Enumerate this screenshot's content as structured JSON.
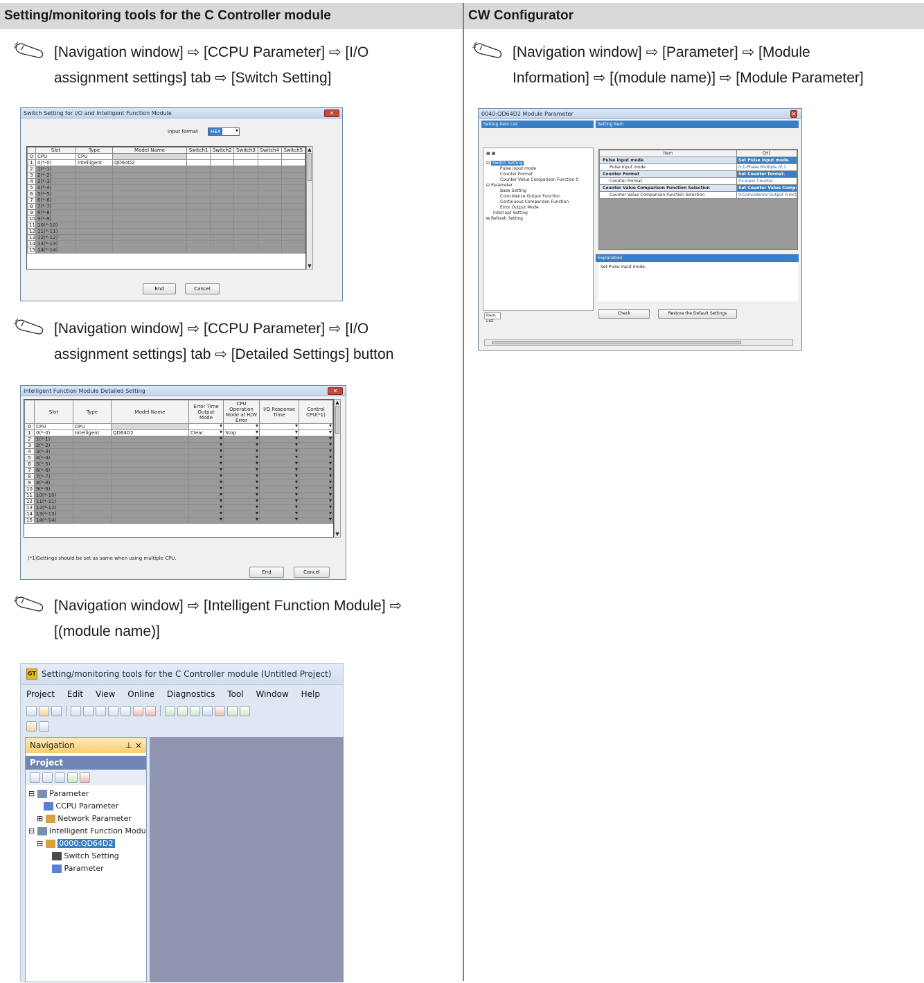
{
  "headers": {
    "left": "Setting/monitoring tools for the C Controller module",
    "right": "CW Configurator"
  },
  "steps": {
    "s1_line1": "[Navigation window] ⇨ [CCPU Parameter] ⇨ [I/O",
    "s1_line2": "assignment settings] tab ⇨ [Switch Setting]",
    "s2_line1": "[Navigation window] ⇨ [CCPU Parameter] ⇨ [I/O",
    "s2_line2": "assignment settings] tab ⇨ [Detailed Settings] button",
    "s3_line1": "[Navigation window] ⇨ [Intelligent Function Module] ⇨",
    "s3_line2": "[(module name)]",
    "r1_line1": "[Navigation window] ⇨ [Parameter] ⇨ [Module",
    "r1_line2": "Information] ⇨ [(module name)] ⇨ [Module Parameter]"
  },
  "switch_dialog": {
    "title": "Switch Setting for I/O and Intelligent Function Module",
    "input_format_label": "Input format",
    "input_format_value": "HEX",
    "columns": [
      "Slot",
      "Type",
      "Model Name",
      "Switch1",
      "Switch2",
      "Switch3",
      "Switch4",
      "Switch5"
    ],
    "rows": [
      {
        "n": "0",
        "slot": "CPU",
        "type": "CPU",
        "model": ""
      },
      {
        "n": "1",
        "slot": "0(*-0)",
        "type": "Intelligent",
        "model": "QD64D2"
      },
      {
        "n": "2",
        "slot": "1(*-1)",
        "type": "",
        "model": ""
      },
      {
        "n": "3",
        "slot": "2(*-2)",
        "type": "",
        "model": ""
      },
      {
        "n": "4",
        "slot": "3(*-3)",
        "type": "",
        "model": ""
      },
      {
        "n": "5",
        "slot": "4(*-4)",
        "type": "",
        "model": ""
      },
      {
        "n": "6",
        "slot": "5(*-5)",
        "type": "",
        "model": ""
      },
      {
        "n": "7",
        "slot": "6(*-6)",
        "type": "",
        "model": ""
      },
      {
        "n": "8",
        "slot": "7(*-7)",
        "type": "",
        "model": ""
      },
      {
        "n": "9",
        "slot": "8(*-8)",
        "type": "",
        "model": ""
      },
      {
        "n": "10",
        "slot": "9(*-9)",
        "type": "",
        "model": ""
      },
      {
        "n": "11",
        "slot": "10(*-10)",
        "type": "",
        "model": ""
      },
      {
        "n": "12",
        "slot": "11(*-11)",
        "type": "",
        "model": ""
      },
      {
        "n": "13",
        "slot": "12(*-12)",
        "type": "",
        "model": ""
      },
      {
        "n": "14",
        "slot": "13(*-13)",
        "type": "",
        "model": ""
      },
      {
        "n": "15",
        "slot": "14(*-14)",
        "type": "",
        "model": ""
      }
    ],
    "end_label": "End",
    "cancel_label": "Cancel"
  },
  "detail_dialog": {
    "title": "Intelligent Function Module Detailed Setting",
    "columns": [
      "Slot",
      "Type",
      "Model Name",
      "Error Time Output Mode",
      "CPU Operation Mode at H/W Error",
      "I/O Response Time",
      "Control CPU(*1)"
    ],
    "rows": [
      {
        "n": "0",
        "slot": "CPU",
        "type": "CPU",
        "model": "",
        "err": "",
        "cpu": ""
      },
      {
        "n": "1",
        "slot": "0(*-0)",
        "type": "Intelligent",
        "model": "QD64D2",
        "err": "Clear",
        "cpu": "Stop"
      },
      {
        "n": "2",
        "slot": "1(*-1)",
        "type": "",
        "model": "",
        "err": "",
        "cpu": ""
      },
      {
        "n": "3",
        "slot": "2(*-2)",
        "type": "",
        "model": "",
        "err": "",
        "cpu": ""
      },
      {
        "n": "4",
        "slot": "3(*-3)",
        "type": "",
        "model": "",
        "err": "",
        "cpu": ""
      },
      {
        "n": "5",
        "slot": "4(*-4)",
        "type": "",
        "model": "",
        "err": "",
        "cpu": ""
      },
      {
        "n": "6",
        "slot": "5(*-5)",
        "type": "",
        "model": "",
        "err": "",
        "cpu": ""
      },
      {
        "n": "7",
        "slot": "6(*-6)",
        "type": "",
        "model": "",
        "err": "",
        "cpu": ""
      },
      {
        "n": "8",
        "slot": "7(*-7)",
        "type": "",
        "model": "",
        "err": "",
        "cpu": ""
      },
      {
        "n": "9",
        "slot": "8(*-8)",
        "type": "",
        "model": "",
        "err": "",
        "cpu": ""
      },
      {
        "n": "10",
        "slot": "9(*-9)",
        "type": "",
        "model": "",
        "err": "",
        "cpu": ""
      },
      {
        "n": "11",
        "slot": "10(*-10)",
        "type": "",
        "model": "",
        "err": "",
        "cpu": ""
      },
      {
        "n": "12",
        "slot": "11(*-11)",
        "type": "",
        "model": "",
        "err": "",
        "cpu": ""
      },
      {
        "n": "13",
        "slot": "12(*-12)",
        "type": "",
        "model": "",
        "err": "",
        "cpu": ""
      },
      {
        "n": "14",
        "slot": "13(*-13)",
        "type": "",
        "model": "",
        "err": "",
        "cpu": ""
      },
      {
        "n": "15",
        "slot": "14(*-14)",
        "type": "",
        "model": "",
        "err": "",
        "cpu": ""
      }
    ],
    "footnote": "(*1)Settings should be set as same when using multiple CPU.",
    "end_label": "End",
    "cancel_label": "Cancel"
  },
  "gx_window": {
    "title": "Setting/monitoring tools for the C Controller module (Untitled Project)",
    "logo": "GT",
    "menu": [
      "Project",
      "Edit",
      "View",
      "Online",
      "Diagnostics",
      "Tool",
      "Window",
      "Help"
    ],
    "nav_title": "Navigation",
    "nav_pin": "⊥ ×",
    "project_label": "Project",
    "tree": {
      "parameter": "Parameter",
      "ccpu": "CCPU Parameter",
      "network": "Network Parameter",
      "ifm": "Intelligent Function Modu",
      "module": "0000:QD64D2",
      "switch": "Switch Setting",
      "param": "Parameter"
    }
  },
  "cw_dialog": {
    "title": "0040:QD64D2 Module Parameter",
    "setting_item_list": "Setting Item List",
    "setting_item": "Setting Item",
    "tree": [
      "Switch Setting",
      "Pulse input mode",
      "Counter Format",
      "Counter Value Comparison Function S",
      "Parameter",
      "Base Setting",
      "Coincidence Output Function",
      "Continuous Comparison Function",
      "Error Output Mode",
      "Interrupt Setting",
      "Refresh Setting"
    ],
    "col_item": "Item",
    "col_ch1": "CH1",
    "rows": [
      {
        "item": "Pulse input mode",
        "val": "Set Pulse input mode."
      },
      {
        "item": "Pulse input mode",
        "val": "0:1-Phase Multiple of 1"
      },
      {
        "item": "Counter Format",
        "val": "Set Counter format."
      },
      {
        "item": "Counter Format",
        "val": "0:Linear Counter"
      },
      {
        "item": "Counter Value Comparison Function Selection",
        "val": "Set Counter Value Compar"
      },
      {
        "item": "Counter Value Comparison Function Selection",
        "val": "0:Coincidence Output Functi"
      }
    ],
    "explanation": "Explanation",
    "explanation_text": "Set Pulse input mode.",
    "item_list_tab": "Item List",
    "check_label": "Check",
    "restore_label": "Restore the Default Settings"
  }
}
